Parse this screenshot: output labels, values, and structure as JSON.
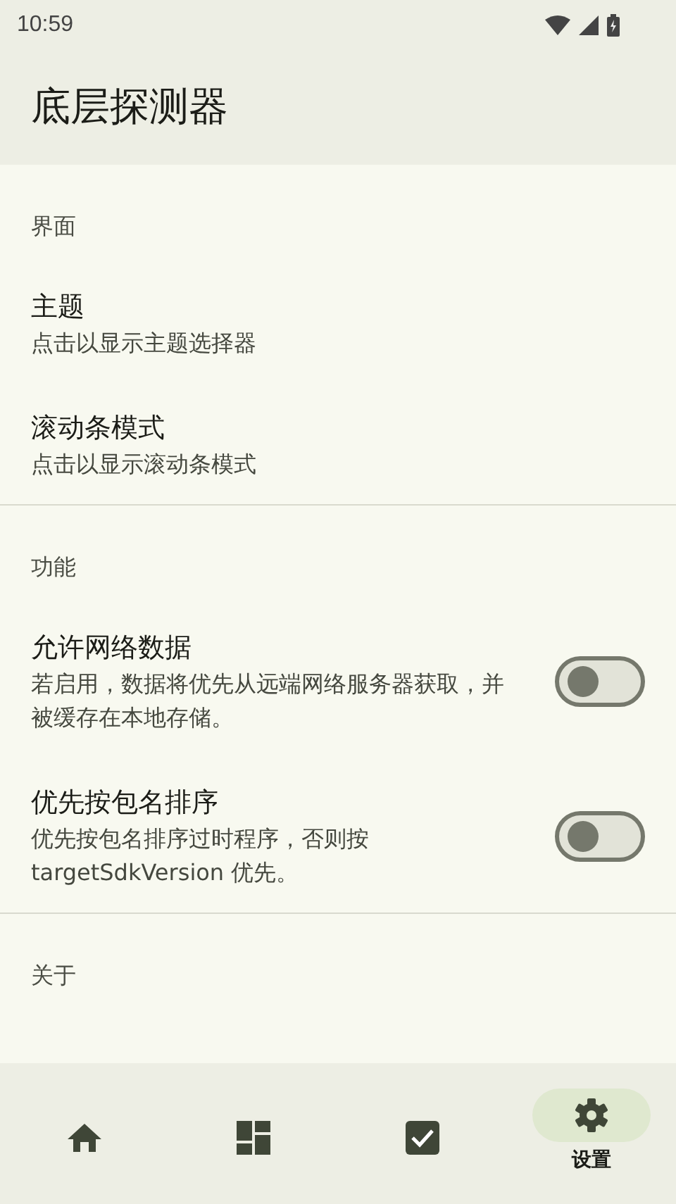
{
  "status_bar": {
    "time": "10:59"
  },
  "app_bar": {
    "title": "底层探测器"
  },
  "sections": [
    {
      "title": "界面",
      "items": [
        {
          "kind": "text",
          "title": "主题",
          "summary": "点击以显示主题选择器"
        },
        {
          "kind": "text",
          "title": "滚动条模式",
          "summary": "点击以显示滚动条模式"
        }
      ]
    },
    {
      "title": "功能",
      "items": [
        {
          "kind": "switch",
          "title": "允许网络数据",
          "summary": "若启用，数据将优先从远端网络服务器获取，并被缓存在本地存储。",
          "on": false
        },
        {
          "kind": "switch",
          "title": "优先按包名排序",
          "summary": "优先按包名排序过时程序，否则按 targetSdkVersion 优先。",
          "on": false
        }
      ]
    },
    {
      "title": "关于"
    }
  ],
  "bottom_nav": [
    {
      "kind": "home",
      "selected": false
    },
    {
      "kind": "dashboard",
      "selected": false
    },
    {
      "kind": "check",
      "selected": false
    },
    {
      "kind": "settings",
      "label": "设置",
      "selected": true
    }
  ]
}
